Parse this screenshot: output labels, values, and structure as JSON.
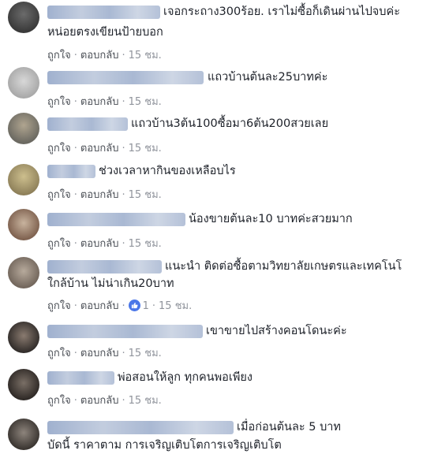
{
  "actions": {
    "like": "ถูกใจ",
    "reply": "ตอบกลับ"
  },
  "comments": [
    {
      "text_lines": [
        "เจอกระถาง300ร้อย. เราไม่ซื้อก็เดินผ่านไปจบค่ะ",
        "หน่อยตรงเขียนป้ายบอก"
      ],
      "time": "15 ชม.",
      "likes": ""
    },
    {
      "text_lines": [
        "แถวบ้านต้นละ25บาทค่ะ"
      ],
      "time": "15 ชม.",
      "likes": ""
    },
    {
      "text_lines": [
        "แถวบ้าน3ต้น100ซื้อมา6ต้น200สวยเลย"
      ],
      "time": "15 ชม.",
      "likes": ""
    },
    {
      "text_lines": [
        "ช่วงเวลาหากินของเหลือบไร"
      ],
      "time": "15 ชม.",
      "likes": ""
    },
    {
      "text_lines": [
        "น้องขายต้นละ10 บาทค่ะสวยมาก"
      ],
      "time": "15 ชม.",
      "likes": ""
    },
    {
      "text_lines": [
        "แนะนำ ติดต่อซื้อตามวิทยาลัยเกษตรและเทคโนโ",
        "ใกล้บ้าน ไม่น่าเกิน20บาท"
      ],
      "time": "15 ชม.",
      "likes": "1"
    },
    {
      "text_lines": [
        "เขาขายไปสร้างคอนโดนะค่ะ"
      ],
      "time": "15 ชม.",
      "likes": ""
    },
    {
      "text_lines": [
        "พ่อสอนให้ลูก ทุกคนพอเพียง"
      ],
      "time": "15 ชม.",
      "likes": ""
    },
    {
      "text_lines": [
        "เมื่อก่อนต้นละ 5 บาท",
        "บัดนี้ ราคาตาม การเจริญเติบโตการเจริญเติบโต"
      ],
      "time": "",
      "likes": ""
    }
  ],
  "colors": {
    "link": "#4b4f56",
    "meta": "#90949c",
    "like_badge": "#4a76e8",
    "name_blur": "#9aaccb"
  }
}
